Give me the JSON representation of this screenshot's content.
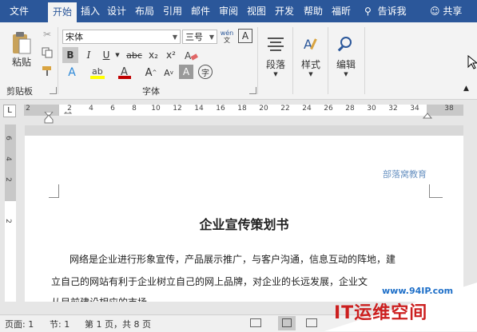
{
  "tabs": [
    "文件",
    "开始",
    "插入",
    "设计",
    "布局",
    "引用",
    "邮件",
    "审阅",
    "视图",
    "开发",
    "帮助",
    "福昕"
  ],
  "tell_me": "告诉我",
  "share": "共享",
  "clipboard": {
    "paste": "粘贴",
    "group": "剪贴板"
  },
  "font": {
    "name": "宋体",
    "size": "三号",
    "bold": "B",
    "italic": "I",
    "underline": "U",
    "strike": "abc",
    "sub": "x₂",
    "sup": "x²",
    "group": "字体"
  },
  "paragraph": {
    "label": "段落"
  },
  "styles": {
    "label": "样式"
  },
  "editing": {
    "label": "编辑"
  },
  "ruler_h": [
    "2",
    "2",
    "4",
    "6",
    "8",
    "10",
    "12",
    "14",
    "16",
    "18",
    "20",
    "22",
    "24",
    "26",
    "28",
    "30",
    "32",
    "34",
    "38"
  ],
  "ruler_v": [
    "6",
    "4",
    "2",
    "2"
  ],
  "doc": {
    "header_text": "部落窝教育",
    "title": "企业宣传策划书",
    "line1": "网络是企业进行形象宣传，产品展示推广，与客户沟通，信息互动的阵地，建",
    "line2": "立自己的网站有利于企业树立自己的网上品牌，对企业的长远发展，企业文",
    "line3": "从目前建设相应的市场..."
  },
  "status": {
    "page": "页面: 1",
    "section": "节: 1",
    "pages": "第 1 页，共 8 页"
  },
  "watermark": {
    "url": "www.94IP.com",
    "brand": "IT运维空间"
  },
  "colors": {
    "accent": "#2b579a",
    "watermark_blue": "#1e6fc8",
    "watermark_red": "#cc1f1f"
  }
}
